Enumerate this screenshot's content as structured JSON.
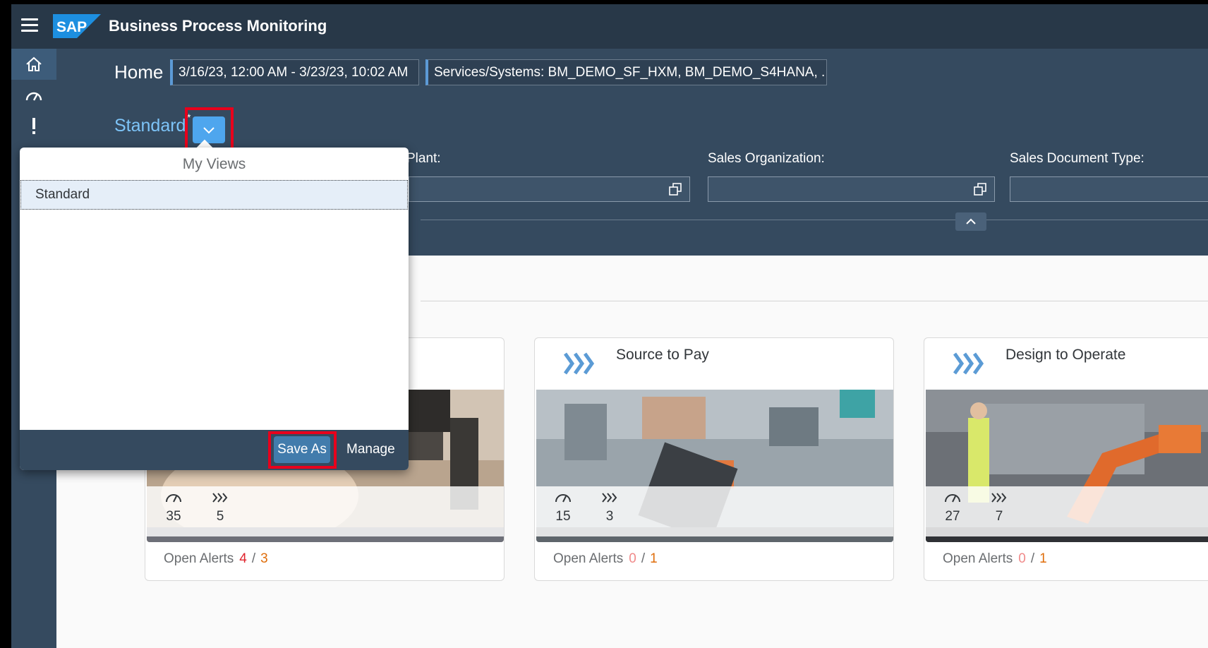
{
  "shell": {
    "logo_text": "SAP",
    "app_title": "Business Process Monitoring"
  },
  "nav": {
    "items": [
      "home-icon",
      "speedometer-icon",
      "alert-icon"
    ]
  },
  "header": {
    "page_title": "Home",
    "date_range": "3/16/23, 12:00 AM - 3/23/23, 10:02 AM",
    "services": "Services/Systems: BM_DEMO_SF_HXM, BM_DEMO_S4HANA, ..."
  },
  "variant": {
    "name": "Standard",
    "dirty_marker": "*"
  },
  "filters": [
    {
      "label": "Plant:",
      "value": ""
    },
    {
      "label": "Sales Organization:",
      "value": ""
    },
    {
      "label": "Sales Document Type:",
      "value": ""
    }
  ],
  "popover": {
    "title": "My Views",
    "items": [
      "Standard"
    ],
    "save_as": "Save As",
    "manage": "Manage"
  },
  "cards": [
    {
      "title": "",
      "kpi_count": "35",
      "process_count": "5",
      "alerts_label": "Open Alerts",
      "alerts_red": "4",
      "alerts_sep": "/",
      "alerts_orange": "3"
    },
    {
      "title": "Source to Pay",
      "kpi_count": "15",
      "process_count": "3",
      "alerts_label": "Open Alerts",
      "alerts_red": "0",
      "alerts_sep": "/",
      "alerts_orange": "1"
    },
    {
      "title": "Design to Operate",
      "kpi_count": "27",
      "process_count": "7",
      "alerts_label": "Open Alerts",
      "alerts_red": "0",
      "alerts_sep": "/",
      "alerts_orange": "1"
    }
  ],
  "colors": {
    "shell": "#283848",
    "filterbar": "#354a5f",
    "accent": "#4ea6ee",
    "highlight": "#e8001c"
  }
}
